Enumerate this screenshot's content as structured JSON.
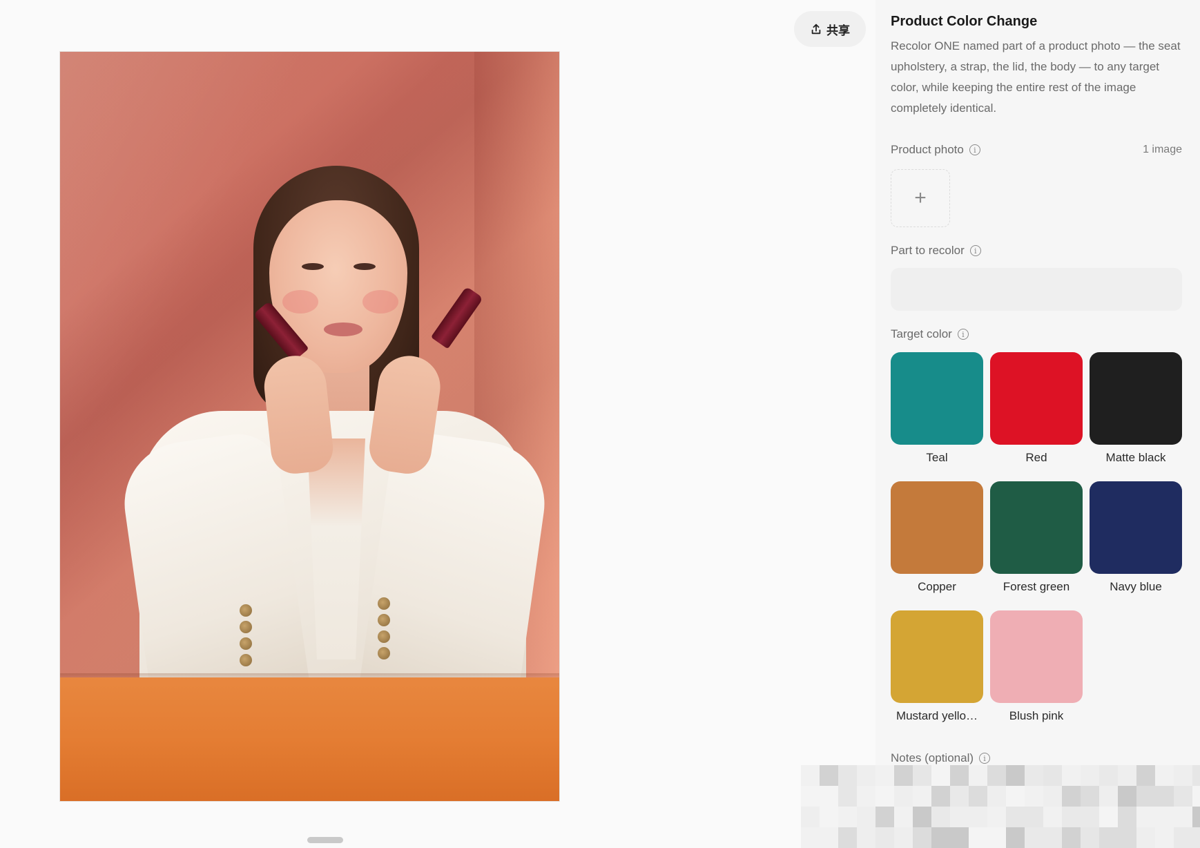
{
  "toolbar": {
    "share_label": "共享"
  },
  "panel": {
    "title": "Product Color Change",
    "description": "Recolor ONE named part of a product photo — the seat upholstery, a strap, the lid, the body — to any target color, while keeping the entire rest of the image completely identical.",
    "product_photo": {
      "label": "Product photo",
      "count": "1 image",
      "add_symbol": "+"
    },
    "part_to_recolor": {
      "label": "Part to recolor",
      "value": "",
      "placeholder": ""
    },
    "target_color": {
      "label": "Target color",
      "options": [
        {
          "name": "Teal",
          "color": "#178c8a"
        },
        {
          "name": "Red",
          "color": "#dd1225"
        },
        {
          "name": "Matte black",
          "color": "#1f1f1f"
        },
        {
          "name": "Copper",
          "color": "#c47a3b"
        },
        {
          "name": "Forest green",
          "color": "#1f5c45"
        },
        {
          "name": "Navy blue",
          "color": "#1f2c60"
        },
        {
          "name": "Mustard yello…",
          "color": "#d4a534"
        },
        {
          "name": "Blush pink",
          "color": "#efaeb4"
        }
      ]
    },
    "notes": {
      "label": "Notes (optional)"
    }
  },
  "colors": {
    "panel_bg": "#f6f6f6",
    "canvas_bg": "#fafafa",
    "accent_text": "#1a1a1a"
  }
}
